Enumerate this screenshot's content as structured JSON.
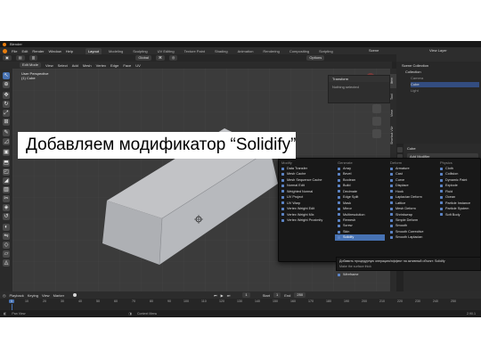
{
  "title_bar": {
    "app_title": "Blender"
  },
  "menu": [
    "File",
    "Edit",
    "Render",
    "Window",
    "Help"
  ],
  "workspaces": [
    "Layout",
    "Modeling",
    "Sculpting",
    "UV Editing",
    "Texture Paint",
    "Shading",
    "Animation",
    "Rendering",
    "Compositing",
    "Scripting"
  ],
  "active_workspace": "Layout",
  "top_right": {
    "scene": "Scene",
    "view_layer": "View Layer"
  },
  "header": {
    "mode": "Edit Mode",
    "menus": [
      "View",
      "Select",
      "Add",
      "Mesh",
      "Vertex",
      "Edge",
      "Face",
      "UV"
    ],
    "transform_orientation": "Global",
    "options": "Options"
  },
  "viewport": {
    "view_label": "User Perspective",
    "object_label": "(1) Cube",
    "banner": "Добавляем модификатор “Solidify”"
  },
  "transform_panel": {
    "title": "Transform",
    "text": "Nothing selected"
  },
  "sidebar_tabs": [
    "Item",
    "Tool",
    "View",
    "Shortcut VUr"
  ],
  "outliner": {
    "items": [
      {
        "label": "Scene Collection",
        "state": "normal"
      },
      {
        "label": "Collection",
        "state": "normal"
      },
      {
        "label": "Camera",
        "state": "dim"
      },
      {
        "label": "Cube",
        "state": "selected"
      },
      {
        "label": "Light",
        "state": "dim"
      }
    ]
  },
  "properties": {
    "object_name": "Cube",
    "add_modifier": "Add Modifier"
  },
  "modifier_menu": {
    "columns": [
      {
        "header": "Modify",
        "items": [
          "Data Transfer",
          "Mesh Cache",
          "Mesh Sequence Cache",
          "Normal Edit",
          "Weighted Normal",
          "UV Project",
          "UV Warp",
          "Vertex Weight Edit",
          "Vertex Weight Mix",
          "Vertex Weight Proximity"
        ]
      },
      {
        "header": "Generate",
        "items": [
          "Array",
          "Bevel",
          "Boolean",
          "Build",
          "Decimate",
          "Edge Split",
          "Mask",
          "Mirror",
          "Multiresolution",
          "Remesh",
          "Screw",
          "Skin",
          "Solidify"
        ]
      },
      {
        "header": "Deform",
        "items": [
          "Armature",
          "Cast",
          "Curve",
          "Displace",
          "Hook",
          "Laplacian Deform",
          "Lattice",
          "Mesh Deform",
          "Shrinkwrap",
          "Simple Deform",
          "Smooth",
          "Smooth Corrective",
          "Smooth Laplacian"
        ]
      },
      {
        "header": "Physics",
        "items": [
          "Cloth",
          "Collision",
          "Dynamic Paint",
          "Explode",
          "Fluid",
          "Ocean",
          "Particle Instance",
          "Particle System",
          "Soft Body"
        ]
      }
    ],
    "highlighted": "Solidify",
    "extra_item": "Wireframe"
  },
  "tooltip": {
    "line1": "Добавить процедурную операцию/эффект на активный объект:  Solidify",
    "line2": "Make the surface thick"
  },
  "timeline": {
    "menus": [
      "Playback",
      "Keying",
      "View",
      "Marker"
    ],
    "current_frame": "1",
    "start_label": "Start",
    "start": "1",
    "end_label": "End",
    "end": "250",
    "frames": [
      "1",
      "10",
      "20",
      "30",
      "40",
      "50",
      "60",
      "70",
      "80",
      "90",
      "100",
      "110",
      "120",
      "130",
      "140",
      "150",
      "160",
      "170",
      "180",
      "190",
      "200",
      "210",
      "220",
      "230",
      "240",
      "250"
    ]
  },
  "status_bar": {
    "left": "Pan View",
    "center": "Context Menu",
    "version": "2.90.1"
  },
  "colors": {
    "accent": "#4772b3",
    "banner_bg": "#ffffff",
    "banner_text": "#000000",
    "viewport_bg": "#3b3b3b"
  }
}
